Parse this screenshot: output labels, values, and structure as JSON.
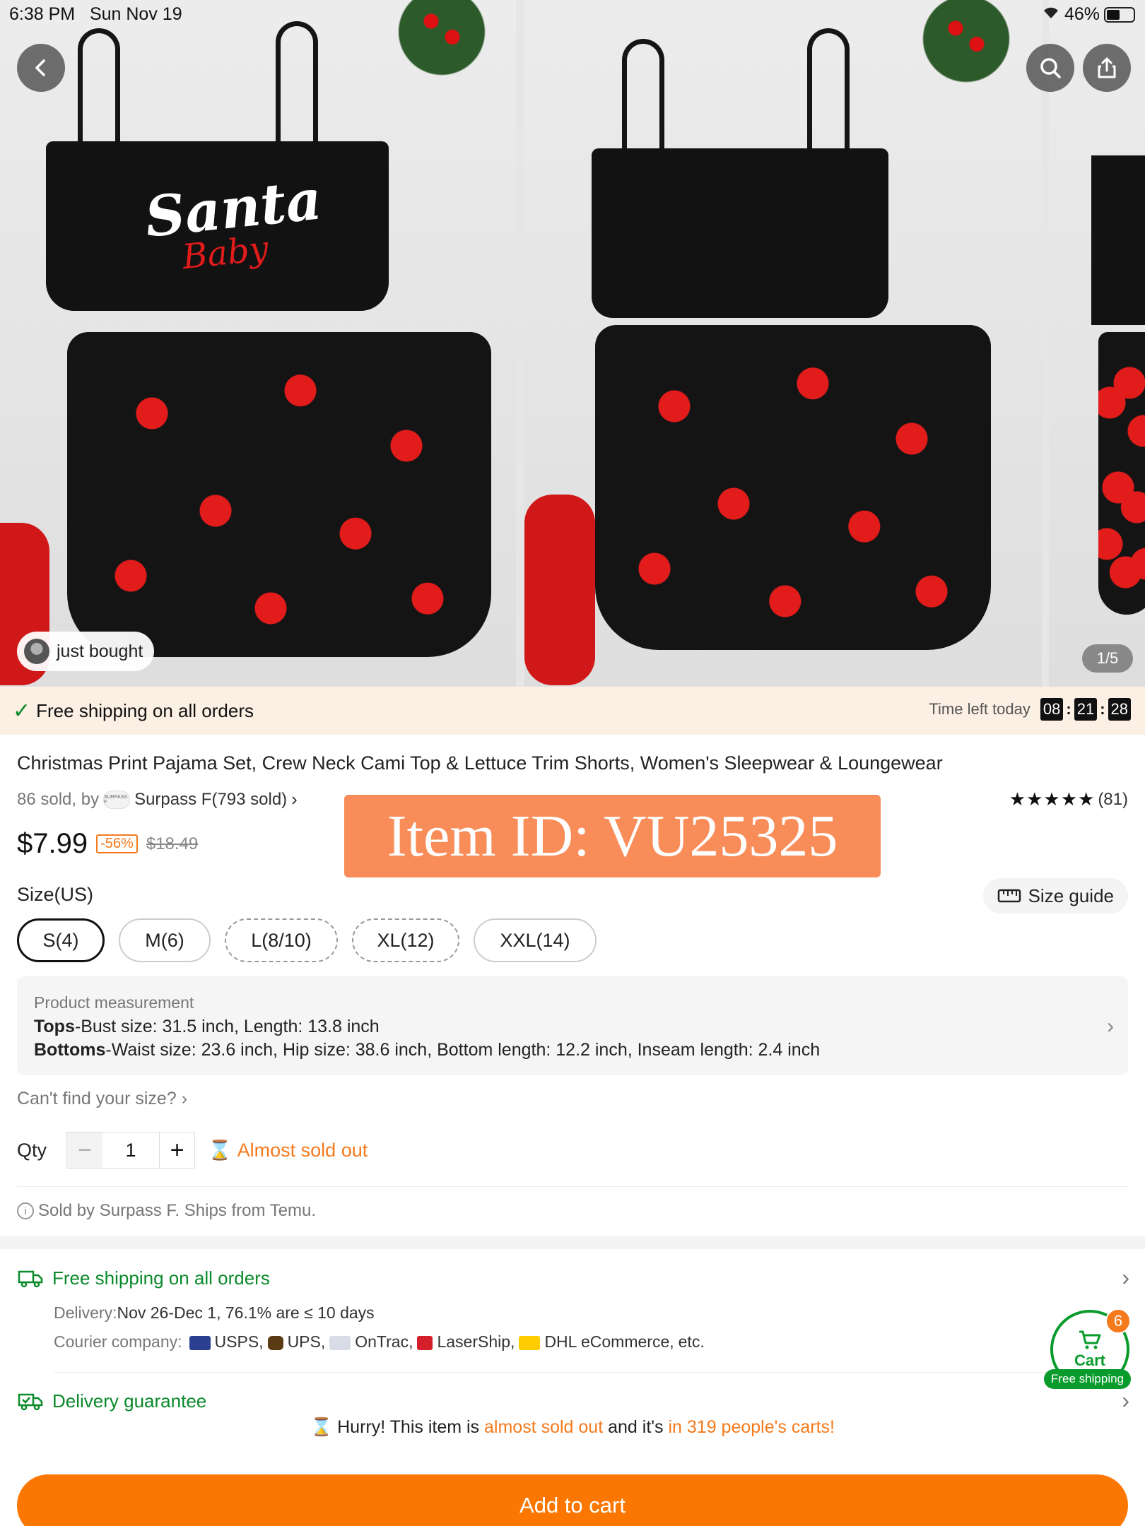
{
  "status_bar": {
    "time": "6:38 PM",
    "date": "Sun Nov 19",
    "battery": "46%"
  },
  "gallery": {
    "print_script": "Santa",
    "print_sub": "Baby",
    "just_bought": "just bought",
    "page_indicator": "1/5"
  },
  "shipping_banner": {
    "text": "Free shipping on all orders",
    "timer_label": "Time left today",
    "hours": "08",
    "minutes": "21",
    "seconds": "28"
  },
  "product": {
    "title": "Christmas Print Pajama Set, Crew Neck Cami Top & Lettuce Trim Shorts, Women's Sleepwear & Loungewear",
    "sold": "86 sold, by",
    "seller": "Surpass F(793 sold)",
    "seller_logo": "SURPASS F",
    "stars": "★★★★★",
    "reviews": "(81)",
    "price": "$7.99",
    "discount": "-56%",
    "original_price": "$18.49",
    "item_id": "Item ID: VU25325"
  },
  "size": {
    "label": "Size(US)",
    "guide": "Size guide",
    "options": [
      "S(4)",
      "M(6)",
      "L(8/10)",
      "XL(12)",
      "XXL(14)"
    ],
    "selected": "S(4)"
  },
  "measurement": {
    "head": "Product measurement",
    "tops_label": "Tops",
    "tops_text": "-Bust size: 31.5 inch, Length: 13.8 inch",
    "bottoms_label": "Bottoms",
    "bottoms_text": "-Waist size: 23.6 inch, Hip size: 38.6 inch, Bottom length: 12.2 inch, Inseam length: 2.4 inch"
  },
  "cant_find": "Can't find your size?",
  "qty": {
    "label": "Qty",
    "value": "1",
    "almost": "Almost sold out"
  },
  "sold_by": "Sold by Surpass F. Ships from Temu.",
  "free_shipping": {
    "title": "Free shipping on all orders",
    "delivery_label": "Delivery:",
    "delivery_value": "Nov 26-Dec 1, 76.1% are ≤ 10 days",
    "courier_label": "Courier company:",
    "couriers": [
      "USPS,",
      "UPS,",
      "OnTrac,",
      "LaserShip,",
      "DHL eCommerce,",
      "etc."
    ]
  },
  "delivery_guarantee": "Delivery guarantee",
  "cart_fab": {
    "label": "Cart",
    "count": "6",
    "free_shipping": "Free shipping"
  },
  "hurry": {
    "p1": "Hurry! This item is ",
    "p2": "almost sold out",
    "p3": " and it's ",
    "p4": "in 319 people's carts!"
  },
  "add_to_cart": "Add to cart",
  "colors": {
    "accent_orange": "#fb7701",
    "green": "#0a8a2a",
    "banner_bg": "#fcefe4",
    "item_id_bg": "#f98d5a"
  }
}
